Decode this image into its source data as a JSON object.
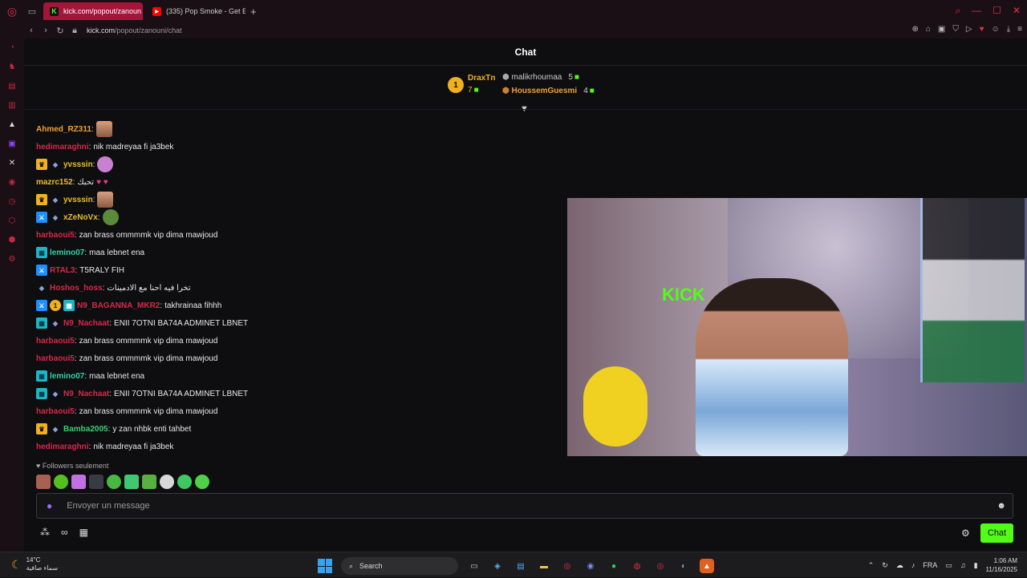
{
  "browser": {
    "tabs": [
      {
        "label": "kick.com/popout/zanoun",
        "active": true
      },
      {
        "label": "(335) Pop Smoke - Get B",
        "active": false
      }
    ],
    "url_host": "kick.com",
    "url_path": "/popout/zanouni/chat"
  },
  "chat": {
    "title": "Chat",
    "leaderboard": {
      "first": {
        "rank": "1",
        "name": "DraxTn",
        "count": "7"
      },
      "second": {
        "name": "malikrhoumaa",
        "count": "5"
      },
      "third": {
        "name": "HoussemGuesmi",
        "count": "4"
      }
    },
    "messages": [
      {
        "user": "Ahmed_RZ311",
        "text": ""
      },
      {
        "user": "hedimaraghni",
        "text": "nik madreyaa fi ja3bek"
      },
      {
        "user": "yvsssin",
        "text": ""
      },
      {
        "user": "mazrc152",
        "text": "تحبك"
      },
      {
        "user": "yvsssin",
        "text": ""
      },
      {
        "user": "xZeNoVx",
        "text": ""
      },
      {
        "user": "harbaoui5",
        "text": "zan brass ommmmk vip dima mawjoud"
      },
      {
        "user": "lemino07",
        "text": "maa lebnet ena"
      },
      {
        "user": "RTAL3",
        "text": "T5RALY FIH"
      },
      {
        "user": "Hoshos_hoss",
        "text": "تخرا فيه احنا مع الادمينات"
      },
      {
        "user": "N9_BAGANNA_MKR2",
        "text": "takhrainaa fihhh"
      },
      {
        "user": "N9_Nachaat",
        "text": "ENII 7OTNI BA74A ADMINET LBNET"
      },
      {
        "user": "harbaoui5",
        "text": "zan brass ommmmk vip dima mawjoud"
      },
      {
        "user": "harbaoui5",
        "text": "zan brass ommmmk vip dima mawjoud"
      },
      {
        "user": "lemino07",
        "text": "maa lebnet ena"
      },
      {
        "user": "N9_Nachaat",
        "text": "ENII 7OTNI BA74A ADMINET LBNET"
      },
      {
        "user": "harbaoui5",
        "text": "zan brass ommmmk vip dima mawjoud"
      },
      {
        "user": "Bamba2005",
        "text": "y zan nhbk enti tahbet"
      },
      {
        "user": "hedimaraghni",
        "text": "nik madreyaa fi ja3bek"
      }
    ],
    "followers_only": "Followers seulement",
    "input_placeholder": "Envoyer un message",
    "send_label": "Chat"
  },
  "taskbar": {
    "temperature": "14°C",
    "weather_text": "سماء صافية",
    "search_label": "Search",
    "language": "FRA",
    "time": "1:06 AM",
    "date": "11/16/2025"
  }
}
